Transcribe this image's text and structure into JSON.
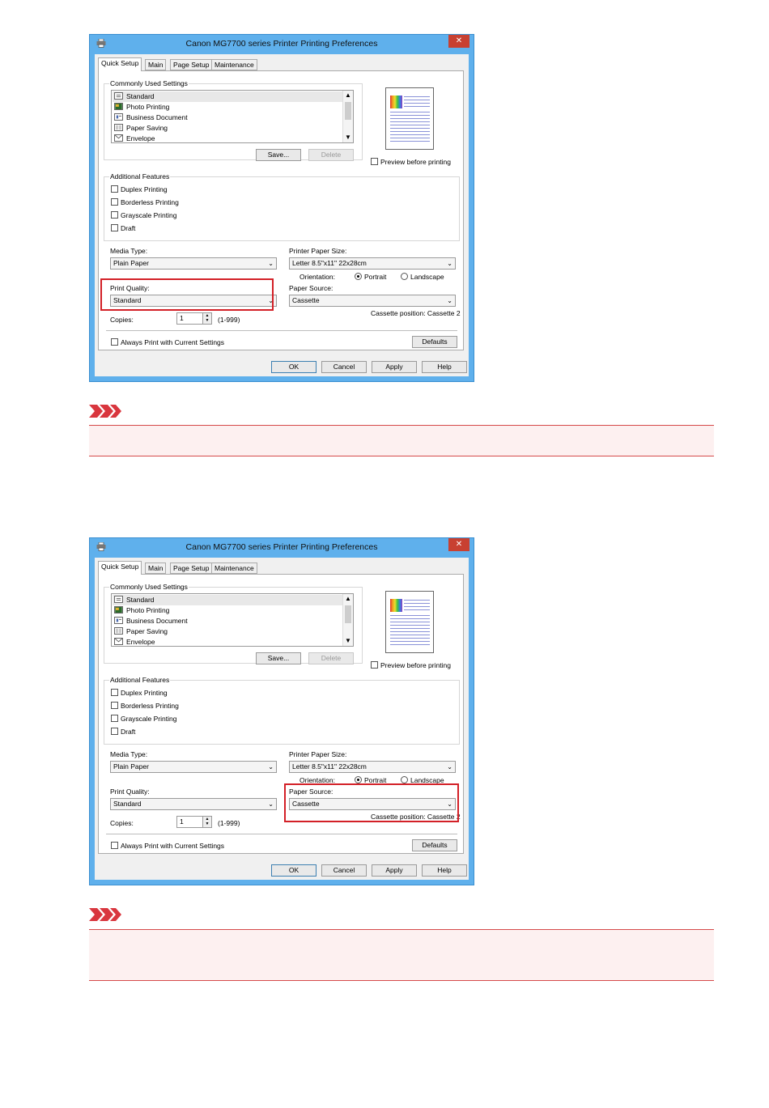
{
  "dialogs": [
    {
      "title": "Canon MG7700 series Printer Printing Preferences",
      "close_symbol": "✕",
      "tabs": [
        {
          "label": "Quick Setup",
          "active": true
        },
        {
          "label": "Main"
        },
        {
          "label": "Page Setup"
        },
        {
          "label": "Maintenance"
        }
      ],
      "commonly_used_settings": {
        "group_label": "Commonly Used Settings",
        "items": [
          "Standard",
          "Photo Printing",
          "Business Document",
          "Paper Saving",
          "Envelope"
        ],
        "selected_index": 0,
        "icons": [
          "document-icon",
          "photo-icon",
          "business-document-icon",
          "paper-saving-icon",
          "envelope-icon"
        ],
        "save_label": "Save...",
        "delete_label": "Delete"
      },
      "preview": {
        "checkbox_label": "Preview before printing",
        "checked": false
      },
      "additional_features": {
        "group_label": "Additional Features",
        "items": [
          "Duplex Printing",
          "Borderless Printing",
          "Grayscale Printing",
          "Draft"
        ]
      },
      "media_type": {
        "label": "Media Type:",
        "value": "Plain Paper"
      },
      "printer_paper_size": {
        "label": "Printer Paper Size:",
        "value": "Letter 8.5\"x11\" 22x28cm"
      },
      "orientation": {
        "label": "Orientation:",
        "portrait": "Portrait",
        "landscape": "Landscape",
        "selected": "Portrait"
      },
      "print_quality": {
        "label": "Print Quality:",
        "value": "Standard"
      },
      "paper_source": {
        "label": "Paper Source:",
        "value": "Cassette",
        "position_text": "Cassette position: Cassette 2"
      },
      "copies": {
        "label": "Copies:",
        "value": "1",
        "range": "(1-999)"
      },
      "always_print": {
        "label": "Always Print with Current Settings",
        "checked": false
      },
      "defaults_label": "Defaults",
      "buttons": {
        "ok": "OK",
        "cancel": "Cancel",
        "apply": "Apply",
        "help": "Help"
      },
      "highlight": "print_quality"
    },
    {
      "title": "Canon MG7700 series Printer Printing Preferences",
      "close_symbol": "✕",
      "tabs": [
        {
          "label": "Quick Setup",
          "active": true
        },
        {
          "label": "Main"
        },
        {
          "label": "Page Setup"
        },
        {
          "label": "Maintenance"
        }
      ],
      "commonly_used_settings": {
        "group_label": "Commonly Used Settings",
        "items": [
          "Standard",
          "Photo Printing",
          "Business Document",
          "Paper Saving",
          "Envelope"
        ],
        "selected_index": 0,
        "icons": [
          "document-icon",
          "photo-icon",
          "business-document-icon",
          "paper-saving-icon",
          "envelope-icon"
        ],
        "save_label": "Save...",
        "delete_label": "Delete"
      },
      "preview": {
        "checkbox_label": "Preview before printing",
        "checked": false
      },
      "additional_features": {
        "group_label": "Additional Features",
        "items": [
          "Duplex Printing",
          "Borderless Printing",
          "Grayscale Printing",
          "Draft"
        ]
      },
      "media_type": {
        "label": "Media Type:",
        "value": "Plain Paper"
      },
      "printer_paper_size": {
        "label": "Printer Paper Size:",
        "value": "Letter 8.5\"x11\" 22x28cm"
      },
      "orientation": {
        "label": "Orientation:",
        "portrait": "Portrait",
        "landscape": "Landscape",
        "selected": "Portrait"
      },
      "print_quality": {
        "label": "Print Quality:",
        "value": "Standard"
      },
      "paper_source": {
        "label": "Paper Source:",
        "value": "Cassette",
        "position_text": "Cassette position: Cassette 2"
      },
      "copies": {
        "label": "Copies:",
        "value": "1",
        "range": "(1-999)"
      },
      "always_print": {
        "label": "Always Print with Current Settings",
        "checked": false
      },
      "defaults_label": "Defaults",
      "buttons": {
        "ok": "OK",
        "cancel": "Cancel",
        "apply": "Apply",
        "help": "Help"
      },
      "highlight": "paper_source"
    }
  ],
  "notes": [
    {
      "icon": "important-icon",
      "text": ""
    },
    {
      "icon": "important-icon",
      "text": ""
    }
  ],
  "colors": {
    "highlight": "#d32027",
    "note_border": "#d64a4a",
    "note_bg": "#fdf0f0",
    "window_frame": "#5fb0ec"
  }
}
